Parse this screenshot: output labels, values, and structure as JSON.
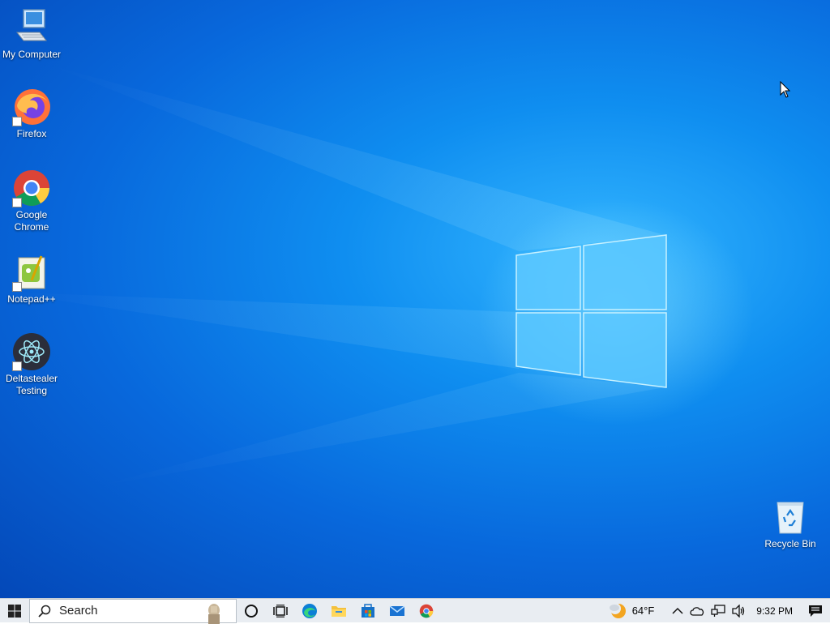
{
  "desktop": {
    "icons": [
      {
        "label": "My Computer",
        "icon": "computer-icon"
      },
      {
        "label": "Firefox",
        "icon": "firefox-icon"
      },
      {
        "label": "Google\nChrome",
        "icon": "chrome-icon"
      },
      {
        "label": "Notepad++",
        "icon": "notepadpp-icon"
      },
      {
        "label": "Deltastealer\nTesting",
        "icon": "electron-app-icon"
      },
      {
        "label": "Recycle Bin",
        "icon": "recycle-bin-icon"
      }
    ]
  },
  "taskbar": {
    "search_placeholder": "Search",
    "pinned": [
      "task-view-icon",
      "edge-icon",
      "file-explorer-icon",
      "store-icon",
      "mail-icon",
      "chrome-icon"
    ],
    "weather_temp": "64°F",
    "clock": "9:32 PM"
  },
  "colors": {
    "accent": "#0a78e0",
    "taskbar_bg": "#e9edf2"
  }
}
